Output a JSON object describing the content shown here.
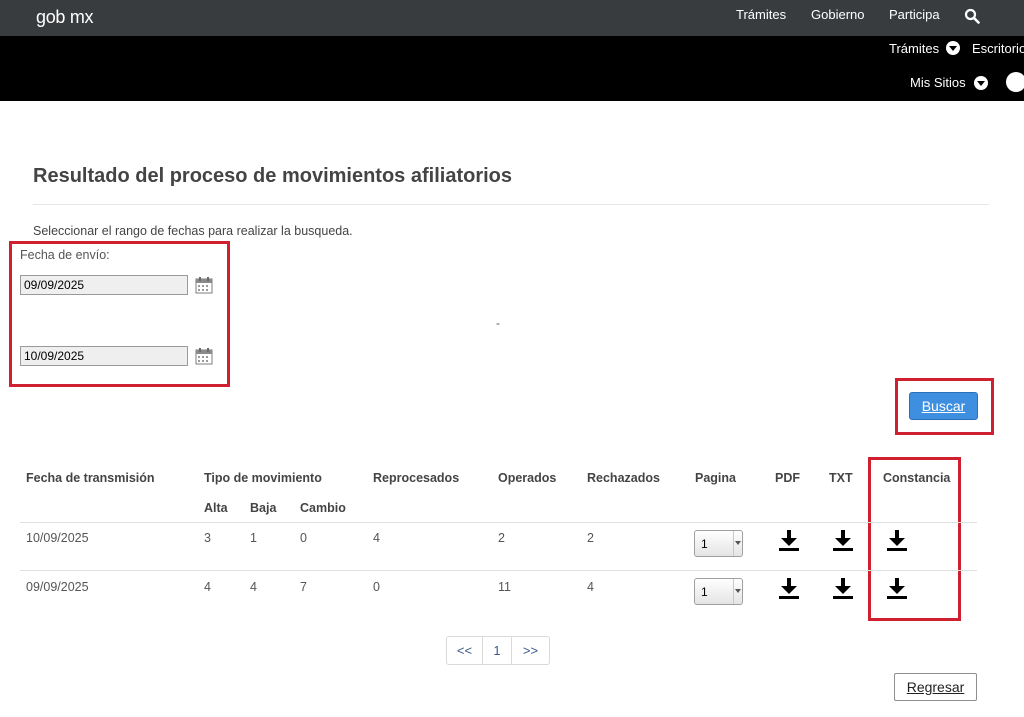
{
  "header": {
    "logo": "gob mx",
    "nav": [
      "Trámites",
      "Gobierno",
      "Participa"
    ]
  },
  "subbar": {
    "items": [
      "Trámites",
      "Escritorio",
      "Mis Sitios"
    ]
  },
  "page": {
    "title": "Resultado del proceso de movimientos afiliatorios",
    "instruction": "Seleccionar el rango de fechas para realizar la busqueda.",
    "date_label": "Fecha de envío:",
    "date_from": "09/09/2025",
    "date_to": "10/09/2025",
    "range_separator": "-",
    "search_button": "Buscar",
    "back_button": "Regresar"
  },
  "table": {
    "headers": {
      "fecha": "Fecha de transmisión",
      "tipo": "Tipo de movimiento",
      "reprocesados": "Reprocesados",
      "operados": "Operados",
      "rechazados": "Rechazados",
      "pagina": "Pagina",
      "pdf": "PDF",
      "txt": "TXT",
      "constancia": "Constancia"
    },
    "subheaders": {
      "alta": "Alta",
      "baja": "Baja",
      "cambio": "Cambio"
    },
    "rows": [
      {
        "fecha": "10/09/2025",
        "alta": "3",
        "baja": "1",
        "cambio": "0",
        "reprocesados": "4",
        "operados": "2",
        "rechazados": "2",
        "pagina": "1"
      },
      {
        "fecha": "09/09/2025",
        "alta": "4",
        "baja": "4",
        "cambio": "7",
        "reprocesados": "0",
        "operados": "11",
        "rechazados": "4",
        "pagina": "1"
      }
    ]
  },
  "pagination": {
    "prev": "<<",
    "current": "1",
    "next": ">>"
  },
  "colors": {
    "highlight": "#d0202f",
    "primary_button": "#3f8fe0",
    "topbar": "#393c3e",
    "subbar": "#000000"
  }
}
